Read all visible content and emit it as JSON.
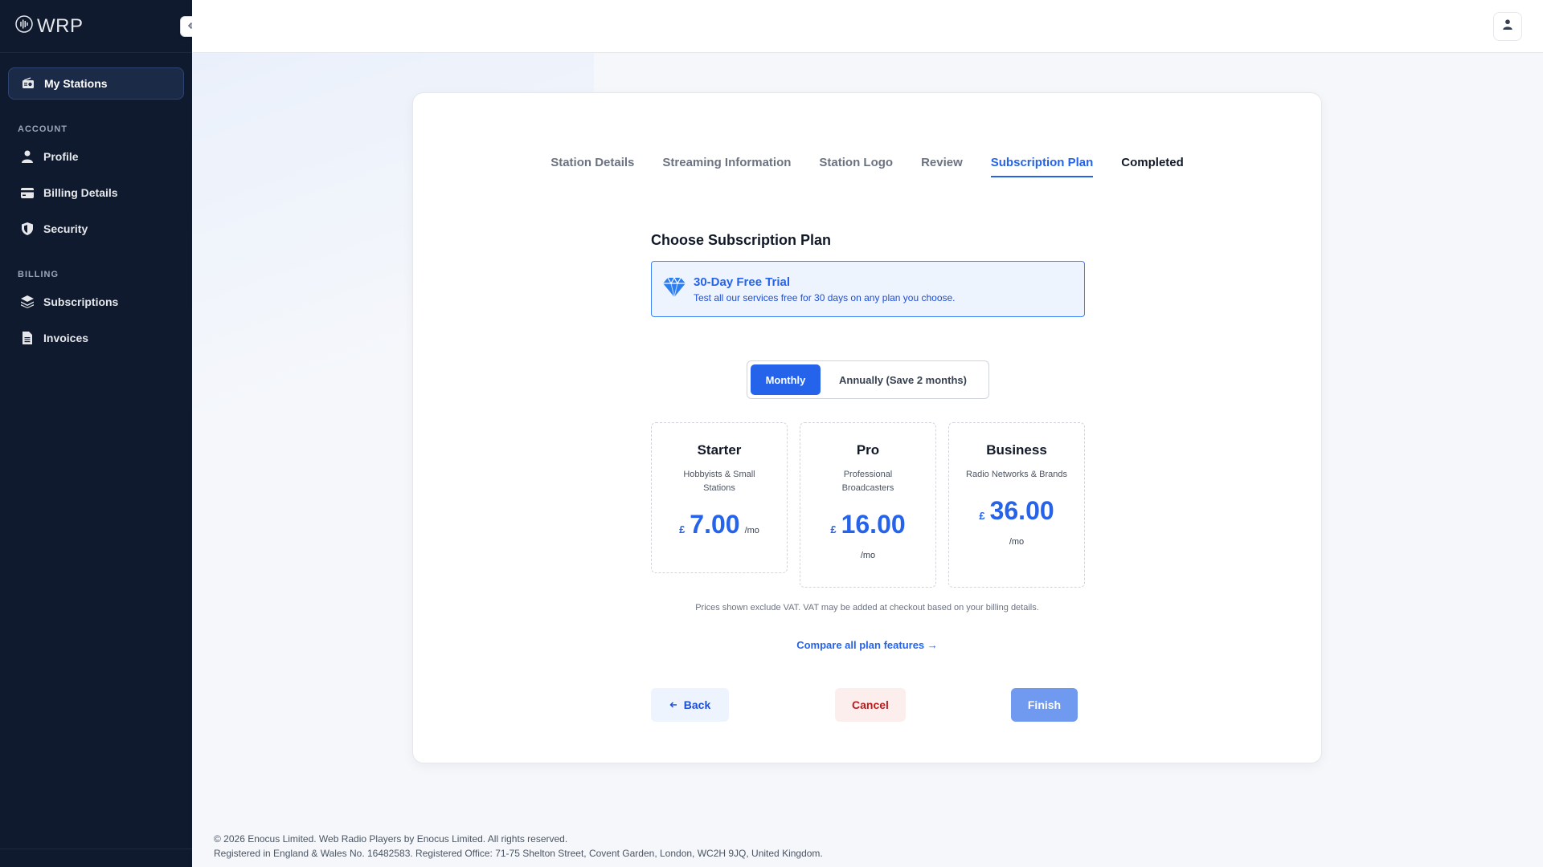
{
  "brand": {
    "logo_text": "WRP"
  },
  "sidebar": {
    "primary": {
      "label": "My Stations",
      "icon": "radio-icon"
    },
    "sections": [
      {
        "title": "ACCOUNT",
        "items": [
          {
            "label": "Profile",
            "icon": "user-icon"
          },
          {
            "label": "Billing Details",
            "icon": "credit-card-icon"
          },
          {
            "label": "Security",
            "icon": "shield-icon"
          }
        ]
      },
      {
        "title": "BILLING",
        "items": [
          {
            "label": "Subscriptions",
            "icon": "layers-icon"
          },
          {
            "label": "Invoices",
            "icon": "document-icon"
          }
        ]
      }
    ]
  },
  "steps": [
    {
      "label": "Station Details",
      "state": "previous"
    },
    {
      "label": "Streaming Information",
      "state": "previous"
    },
    {
      "label": "Station Logo",
      "state": "previous"
    },
    {
      "label": "Review",
      "state": "previous"
    },
    {
      "label": "Subscription Plan",
      "state": "active"
    },
    {
      "label": "Completed",
      "state": "upcoming"
    }
  ],
  "main": {
    "title": "Choose Subscription Plan",
    "trial": {
      "title": "30-Day Free Trial",
      "text": "Test all our services free for 30 days on any plan you choose.",
      "icon": "diamond-icon"
    },
    "billing_toggle": {
      "monthly": "Monthly",
      "annually": "Annually (Save 2 months)",
      "selected": "monthly"
    },
    "plans": [
      {
        "name": "Starter",
        "desc": "Hobbyists & Small Stations",
        "currency": "£",
        "amount": "7.00",
        "per": "/mo"
      },
      {
        "name": "Pro",
        "desc": "Professional Broadcasters",
        "currency": "£",
        "amount": "16.00",
        "per": "/mo"
      },
      {
        "name": "Business",
        "desc": "Radio Networks & Brands",
        "currency": "£",
        "amount": "36.00",
        "per": "/mo"
      }
    ],
    "vat_note": "Prices shown exclude VAT. VAT may be added at checkout based on your billing details.",
    "compare_link": "Compare all plan features →",
    "buttons": {
      "back": "Back",
      "cancel": "Cancel",
      "finish": "Finish"
    }
  },
  "footer": {
    "line1": "© 2026 Enocus Limited. Web Radio Players by Enocus Limited. All rights reserved.",
    "line2": "Registered in England & Wales No. 16482583. Registered Office: 71-75 Shelton Street, Covent Garden, London, WC2H 9JQ, United Kingdom."
  },
  "colors": {
    "accent": "#2563eb",
    "sidebar_bg": "#0f1a2e",
    "cancel": "#b91c1c"
  }
}
